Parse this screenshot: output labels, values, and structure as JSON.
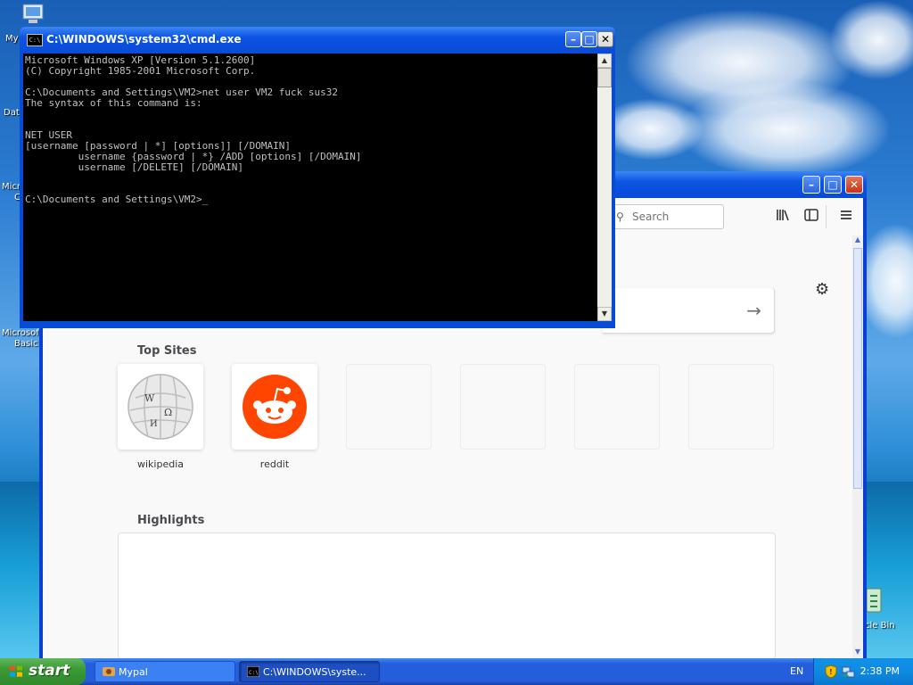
{
  "desktop": {
    "icons": [
      {
        "label": "My"
      },
      {
        "label": "Dat"
      },
      {
        "label": "Micro"
      },
      {
        "label": "C"
      },
      {
        "label": "Microsoft"
      },
      {
        "label": "Basic"
      },
      {
        "label": "cle Bin"
      }
    ]
  },
  "cmd": {
    "title": "C:\\WINDOWS\\system32\\cmd.exe",
    "icon_text": "C:\\",
    "lines": [
      "Microsoft Windows XP [Version 5.1.2600]",
      "(C) Copyright 1985-2001 Microsoft Corp.",
      "",
      "C:\\Documents and Settings\\VM2>net user VM2 fuck sus32",
      "The syntax of this command is:",
      "",
      "",
      "NET USER",
      "[username [password | *] [options]] [/DOMAIN]",
      "         username {password | *} /ADD [options] [/DOMAIN]",
      "         username [/DELETE] [/DOMAIN]",
      "",
      "",
      "C:\\Documents and Settings\\VM2>_"
    ]
  },
  "firefox": {
    "search_placeholder": "Search",
    "top_sites_title": "Top Sites",
    "highlights_title": "Highlights",
    "top_sites": [
      {
        "label": "wikipedia"
      },
      {
        "label": "reddit"
      }
    ]
  },
  "taskbar": {
    "start_label": "start",
    "tasks": [
      {
        "label": "Mypal"
      },
      {
        "label": "C:\\WINDOWS\\syste..."
      }
    ],
    "language": "EN",
    "clock": "2:38 PM"
  },
  "colors": {
    "xp_blue": "#0a4bd6",
    "start_green": "#3c9a35",
    "reddit_orange": "#ff4500"
  }
}
